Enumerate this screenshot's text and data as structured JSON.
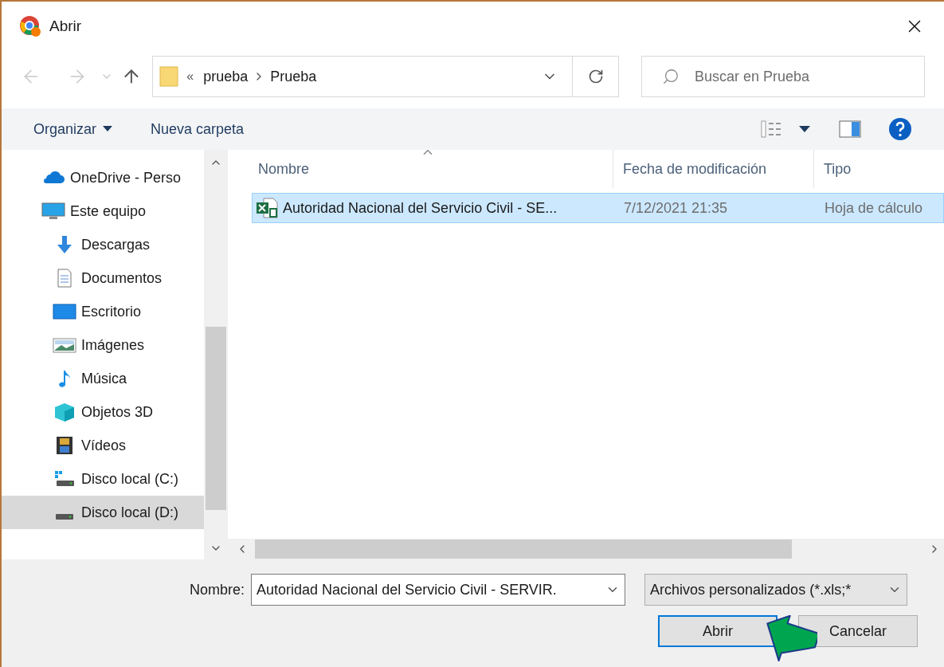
{
  "window": {
    "title": "Abrir"
  },
  "address": {
    "overflow": "«",
    "segments": [
      "prueba",
      "Prueba"
    ]
  },
  "search": {
    "placeholder": "Buscar en Prueba"
  },
  "toolbar": {
    "organize": "Organizar",
    "new_folder": "Nueva carpeta"
  },
  "sidebar": {
    "items": [
      {
        "label": "OneDrive - Perso",
        "kind": "cloud",
        "selected": false
      },
      {
        "label": "Este equipo",
        "kind": "pc",
        "selected": false,
        "children": [
          {
            "label": "Descargas",
            "kind": "download",
            "selected": false
          },
          {
            "label": "Documentos",
            "kind": "document",
            "selected": false
          },
          {
            "label": "Escritorio",
            "kind": "desktop",
            "selected": false
          },
          {
            "label": "Imágenes",
            "kind": "image",
            "selected": false
          },
          {
            "label": "Música",
            "kind": "music",
            "selected": false
          },
          {
            "label": "Objetos 3D",
            "kind": "cube",
            "selected": false
          },
          {
            "label": "Vídeos",
            "kind": "video",
            "selected": false
          },
          {
            "label": "Disco local (C:)",
            "kind": "system-drive",
            "selected": false
          },
          {
            "label": "Disco local (D:)",
            "kind": "drive",
            "selected": true
          }
        ]
      }
    ]
  },
  "table": {
    "columns": [
      "Nombre",
      "Fecha de modificación",
      "Tipo"
    ],
    "rows": [
      {
        "name": "Autoridad Nacional del Servicio Civil - SE...",
        "date": "7/12/2021 21:35",
        "type": "Hoja de cálculo",
        "selected": true
      }
    ]
  },
  "footer": {
    "name_label": "Nombre:",
    "name_value": "Autoridad Nacional del Servicio Civil - SERVIR.",
    "filter": "Archivos personalizados (*.xls;*",
    "buttons": [
      {
        "label": "Abrir",
        "default": true
      },
      {
        "label": "Cancelar",
        "default": false
      }
    ]
  }
}
